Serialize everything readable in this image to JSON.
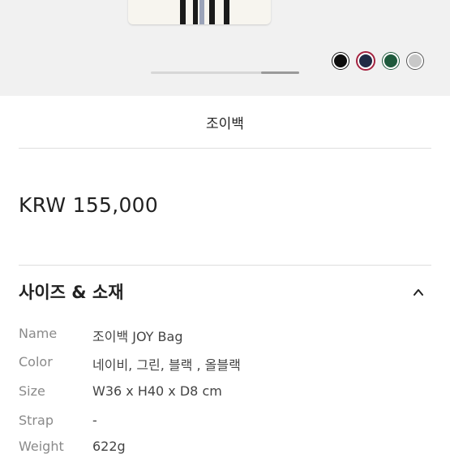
{
  "product": {
    "title": "조이백",
    "price": "KRW 155,000"
  },
  "colors": {
    "swatches": [
      {
        "name": "black",
        "hex": "#0d0d0d"
      },
      {
        "name": "navy-red",
        "hex": "#1f2a44",
        "ring": "#a3223f"
      },
      {
        "name": "green",
        "hex": "#1e5a3c"
      },
      {
        "name": "grey",
        "hex": "#c8c8c8"
      }
    ]
  },
  "carousel": {
    "progress": 0.75
  },
  "details": {
    "section_title": "사이즈 & 소재",
    "rows": [
      {
        "label": "Name",
        "value": "조이백 JOY Bag"
      },
      {
        "label": "Color",
        "value": "네이비, 그린, 블랙 , 올블랙"
      },
      {
        "label": "Size",
        "value": "W36 x H40 x D8 cm"
      },
      {
        "label": "Strap",
        "value": "-"
      },
      {
        "label": "Weight",
        "value": "622g"
      }
    ]
  }
}
